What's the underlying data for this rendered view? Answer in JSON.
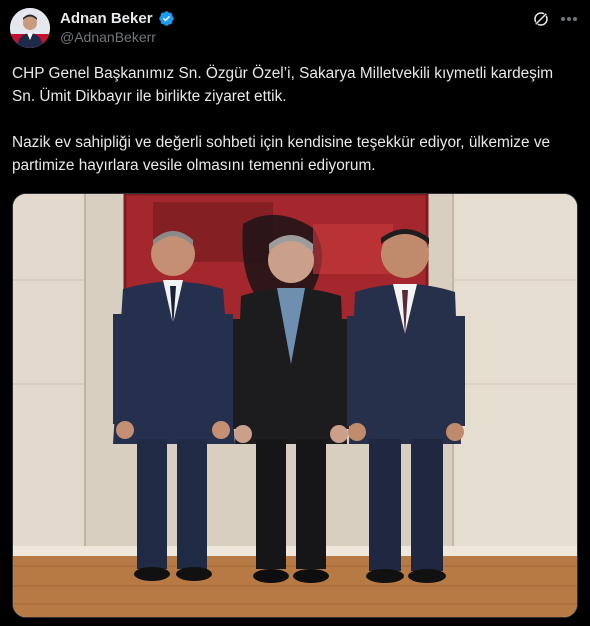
{
  "author": {
    "display_name": "Adnan Beker",
    "handle": "@AdnanBekerr",
    "verified": true,
    "avatar_icon": "profile-photo",
    "verified_icon": "verified-badge-icon",
    "verified_color": "#1d9bf0"
  },
  "actions": {
    "grok_icon": "grok-icon",
    "more_icon": "more-options-icon"
  },
  "tweet": {
    "paragraphs": [
      "CHP Genel Başkanımız Sn. Özgür Özel’i, Sakarya Milletvekili kıymetli kardeşim Sn. Ümit Dikbayır ile birlikte ziyaret ettik.",
      "Nazik ev sahipliği ve değerli sohbeti için kendisine teşekkür ediyor, ülkemize ve partimize hayırlara vesile olmasını temenni ediyorum."
    ]
  },
  "media": {
    "type": "photo",
    "accent_colors": {
      "background_wall": "#d9cfc0",
      "painting": "#a3272c",
      "floor": "#b87a45",
      "suit_navy": "#242c44",
      "suit_black": "#1c1c1f"
    }
  },
  "theme": {
    "background": "#000000",
    "text_primary": "#e7e9ea",
    "text_secondary": "#71767b",
    "border": "#2f3336"
  }
}
